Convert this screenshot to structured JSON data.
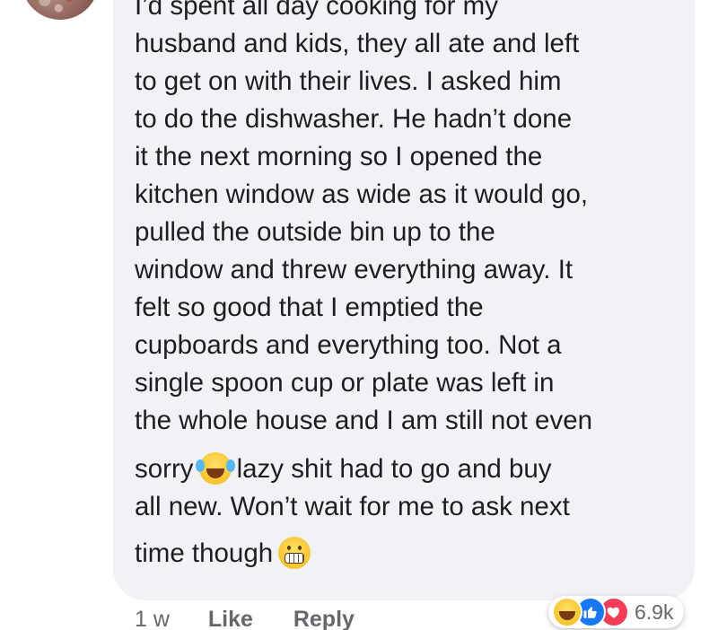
{
  "comment": {
    "lines": [
      "I’d spent all day cooking for my",
      "husband and kids, they all ate and left",
      "to get on with their lives. I asked him",
      "to do the dishwasher. He hadn’t done",
      "it the next morning so I opened the",
      "kitchen window as wide as it would go,",
      "pulled the outside bin up to the",
      "window and threw everything away. It",
      "felt so good that I emptied the",
      "cupboards and everything too. Not a",
      "single spoon cup or plate was left in",
      "the whole house and I am still not even"
    ],
    "line13_before": "sorry",
    "line13_emoji": "tears-of-joy-emoji",
    "line13_after": "lazy shit had to go and buy",
    "line14": "all new. Won’t wait for me to ask next",
    "line15_before": "time though",
    "line15_emoji": "grimacing-face-emoji"
  },
  "actions": {
    "timestamp": "1 w",
    "like_label": "Like",
    "reply_label": "Reply"
  },
  "reactions": {
    "icons": [
      "haha-reaction-icon",
      "like-reaction-icon",
      "love-reaction-icon"
    ],
    "count": "6.9k"
  },
  "colors": {
    "bubble_bg": "#f0f2f5",
    "text": "#1c1e21",
    "meta_text": "#65676b",
    "like_blue": "#1877f2",
    "love_red": "#f33e58"
  }
}
